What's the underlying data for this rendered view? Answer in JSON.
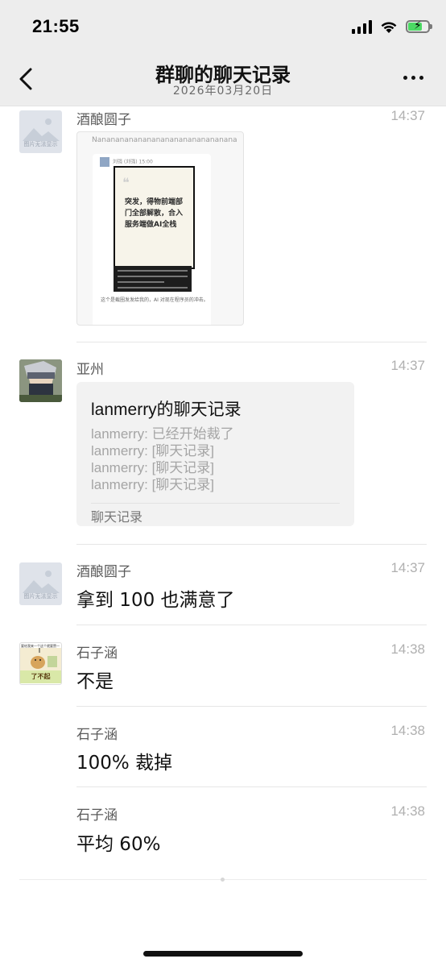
{
  "status_bar": {
    "time": "21:55"
  },
  "header": {
    "title": "群聊的聊天记录",
    "subtitle": "2026年03月20日"
  },
  "messages": [
    {
      "sender": "酒酿圆子",
      "time": "14:37",
      "avatar_text": "图片无法显示",
      "type": "image",
      "image": {
        "top_text": "Nananananananananananananananana",
        "meta": "刘强 (刘强)    15:00",
        "headline": "突发，得物前端部门全部解散，合入服务端做AI全栈",
        "caption": "这个是截圈发发给我的，AI 对现在程序员的冲击。"
      }
    },
    {
      "sender": "亚州",
      "time": "14:37",
      "type": "chat_record",
      "record": {
        "title": "lanmerry的聊天记录",
        "lines": [
          "lanmerry: 已经开始裁了",
          "lanmerry: [聊天记录]",
          "lanmerry: [聊天记录]",
          "lanmerry: [聊天记录]"
        ],
        "footer": "聊天记录"
      }
    },
    {
      "sender": "酒酿圆子",
      "time": "14:37",
      "avatar_text": "图片无法显示",
      "text": "拿到 100 也满意了"
    },
    {
      "sender": "石子涵",
      "time": "14:38",
      "avatar_top_text": "要给我来一个这个就要赞一",
      "avatar_bottom_text": "了不起",
      "text": "不是"
    },
    {
      "sender": "石子涵",
      "time": "14:38",
      "text": "100% 裁掉"
    },
    {
      "sender": "石子涵",
      "time": "14:38",
      "text": "平均 60%"
    }
  ],
  "colors": {
    "header_bg": "#ededed",
    "bubble_bg": "#f2f2f2",
    "battery_green": "#4cd964"
  }
}
